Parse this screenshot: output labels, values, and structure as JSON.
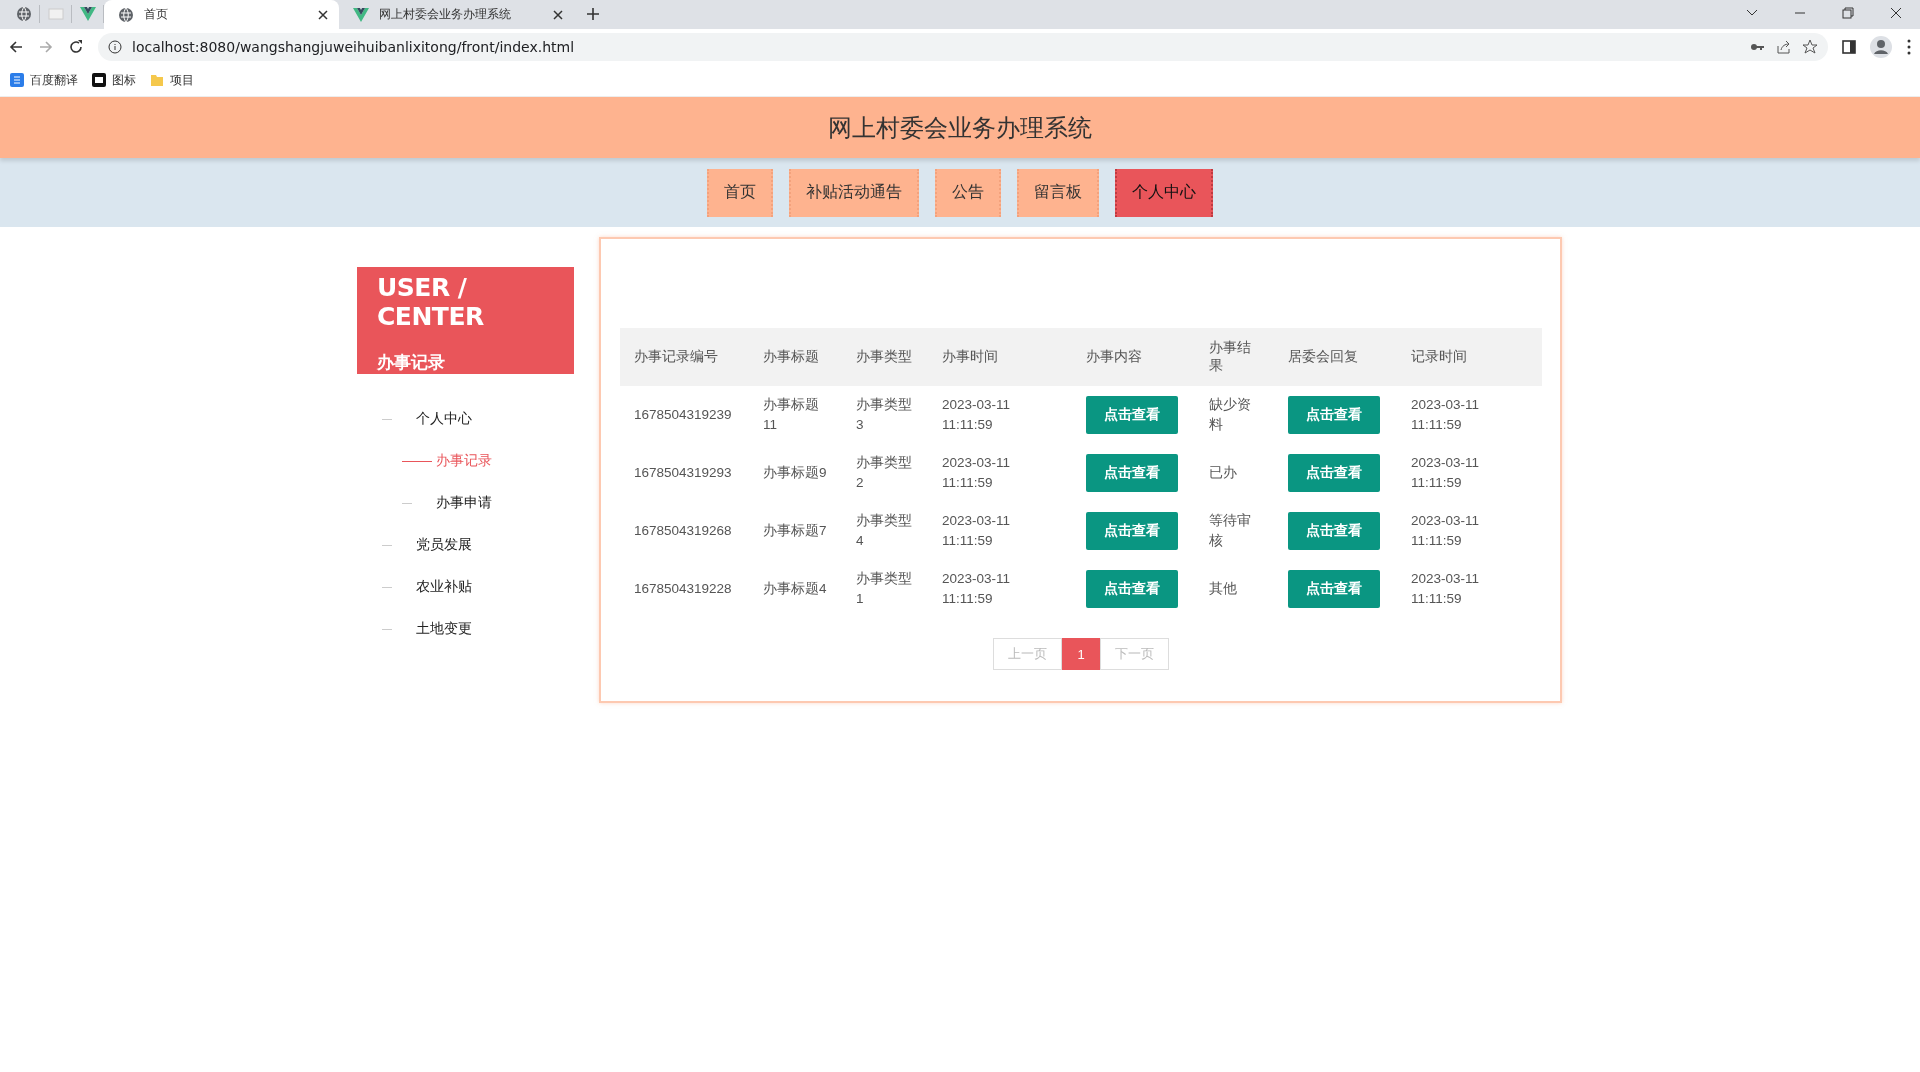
{
  "browser": {
    "tabs": [
      {
        "title": "首页",
        "selected": true
      },
      {
        "title": "网上村委会业务办理系统",
        "selected": false
      }
    ],
    "address": "localhost:8080/wangshangjuweihuibanlixitong/front/index.html",
    "bookmarks": [
      "百度翻译",
      "图标",
      "项目"
    ]
  },
  "header": {
    "title": "网上村委会业务办理系统"
  },
  "nav": [
    {
      "label": "首页",
      "selected": false
    },
    {
      "label": "补贴活动通告",
      "selected": false
    },
    {
      "label": "公告",
      "selected": false
    },
    {
      "label": "留言板",
      "selected": false
    },
    {
      "label": "个人中心",
      "selected": true
    }
  ],
  "sidebar": {
    "title": "USER / CENTER",
    "subtitle": "办事记录",
    "items": [
      {
        "label": "个人中心",
        "selected": false,
        "children": [
          {
            "label": "办事记录",
            "selected": true
          },
          {
            "label": "办事申请",
            "selected": false
          }
        ]
      },
      {
        "label": "党员发展",
        "selected": false
      },
      {
        "label": "农业补贴",
        "selected": false
      },
      {
        "label": "土地变更",
        "selected": false
      }
    ]
  },
  "table": {
    "columns": [
      "办事记录编号",
      "办事标题",
      "办事类型",
      "办事时间",
      "办事内容",
      "办事结果",
      "居委会回复",
      "记录时间"
    ],
    "rows": [
      {
        "id": "1678504319239",
        "title": "办事标题11",
        "type": "办事类型3",
        "time": "2023-03-11 11:11:59",
        "content": "点击查看",
        "result": "缺少资料",
        "reply": "点击查看",
        "record_time": "2023-03-11 11:11:59"
      },
      {
        "id": "1678504319293",
        "title": "办事标题9",
        "type": "办事类型2",
        "time": "2023-03-11 11:11:59",
        "content": "点击查看",
        "result": "已办",
        "reply": "点击查看",
        "record_time": "2023-03-11 11:11:59"
      },
      {
        "id": "1678504319268",
        "title": "办事标题7",
        "type": "办事类型4",
        "time": "2023-03-11 11:11:59",
        "content": "点击查看",
        "result": "等待审核",
        "reply": "点击查看",
        "record_time": "2023-03-11 11:11:59"
      },
      {
        "id": "1678504319228",
        "title": "办事标题4",
        "type": "办事类型1",
        "time": "2023-03-11 11:11:59",
        "content": "点击查看",
        "result": "其他",
        "reply": "点击查看",
        "record_time": "2023-03-11 11:11:59"
      }
    ]
  },
  "pagination": {
    "prev": "上一页",
    "pages": [
      {
        "label": "1",
        "selected": true
      }
    ],
    "next": "下一页"
  }
}
